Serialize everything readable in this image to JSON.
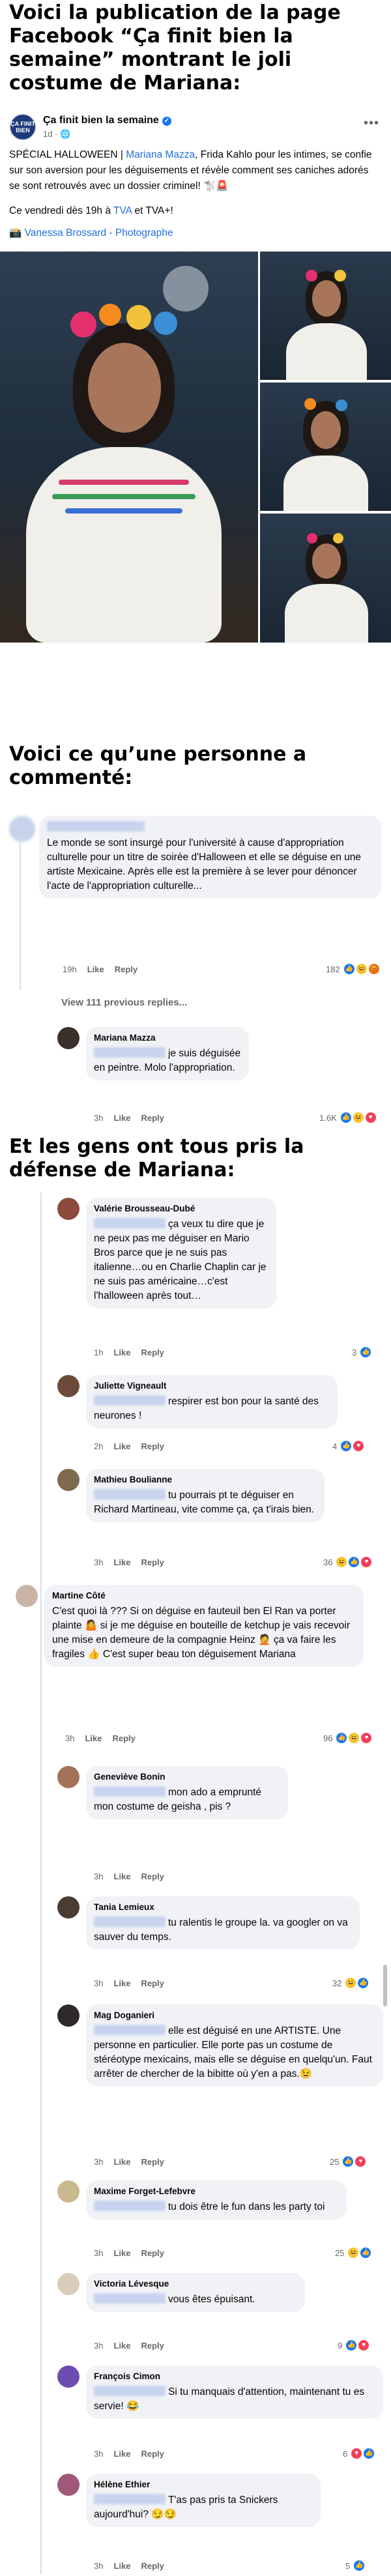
{
  "heading1": [
    "Voici la publication de la page",
    "Facebook “Ça finit bien la",
    "semaine” montrant le joli",
    "costume de Mariana:"
  ],
  "heading2": [
    "Voici ce qu’une personne a",
    "commenté:"
  ],
  "heading3": [
    "Et les gens ont tous pris la",
    "défense de Mariana:"
  ],
  "post": {
    "page_name": "Ça finit bien la semaine",
    "time": "1d",
    "avatar_text": "ÇA FINIT BIEN",
    "text_before": "SPÉCIAL HALLOWEEN | ",
    "text_link": "Mariana Mazza",
    "text_after": ", Frida Kahlo pour les intimes, se confie sur son aversion pour les déguisements et révèle comment ses caniches adorés se sont retrouvés avec un dossier criminel! 🐩🚨",
    "line2_before": "Ce vendredi dès 19h à ",
    "line2_link1": "TVA",
    "line2_mid": " et TVA+!",
    "photo_credit": "📸 Vanessa Brossard - Photographe"
  },
  "first_comment": {
    "text": "Le monde se sont insurgé pour l'université à cause d'appropriation culturelle pour un titre de soirée d'Halloween et elle se déguise en une artiste Mexicaine. Après elle est la première à se lever pour dénoncer l'acte de l'appropriation culturelle...",
    "time": "19h",
    "like": "Like",
    "reply": "Reply",
    "count": "182",
    "view_more": "View 111 previous replies...",
    "reply_name": "Mariana Mazza",
    "reply_text": "je suis déguisée en peintre. Molo l'appropriation.",
    "reply_time": "3h",
    "reply_count": "1.6K"
  },
  "comments": [
    {
      "name": "Valérie Brousseau-Dubé",
      "text": "ça veux tu dire que je ne peux pas me déguiser en Mario Bros parce que je ne suis pas italienne…ou en Charlie Chaplin car je ne suis pas américaine…c'est l'halloween après tout…",
      "time": "1h",
      "count": "3"
    },
    {
      "name": "Juliette Vigneault",
      "text": "respirer est bon pour la santé des neurones !",
      "time": "2h",
      "count": "4"
    },
    {
      "name": "Mathieu Boulianne",
      "text": "tu pourrais pt te déguiser en Richard Martineau, vite comme ça, ça t'irais bien.",
      "time": "3h",
      "count": "36"
    },
    {
      "name": "Martine Côté",
      "text": "C'est quoi là ??? Si on déguise en fauteuil ben  El Ran va porter plainte 🤷 si je me déguise en bouteille de ketchup je vais recevoir une mise en demeure de la compagnie Heinz 🤦 ça va faire les fragiles 👍 C'est super beau ton déguisement Mariana",
      "time": "3h",
      "count": "96"
    },
    {
      "name": "Geneviève Bonin",
      "text": "mon ado a emprunté mon costume de geisha , pis ?",
      "time": "3h",
      "count": ""
    },
    {
      "name": "Tania Lemieux",
      "text": "tu ralentis le groupe la. va googler on va sauver du temps.",
      "time": "3h",
      "count": "32"
    },
    {
      "name": "Mag Doganieri",
      "text": "elle est déguisé en une ARTISTE. Une personne en particulier. Elle porte pas un costume de stéréotype mexicains, mais elle se déguise en quelqu'un. Faut arrêter de chercher de la bibitte où y'en a pas.😉",
      "time": "3h",
      "count": "25"
    },
    {
      "name": "Maxime Forget-Lefebvre",
      "text": "tu dois être le fun dans les party toi",
      "time": "3h",
      "count": "25"
    },
    {
      "name": "Victoria Lévesque",
      "text": "vous êtes épuisant.",
      "time": "3h",
      "count": "9"
    },
    {
      "name": "François Cimon",
      "text": "Si tu manquais d'attention, maintenant tu es servie! 😂",
      "time": "3h",
      "count": "6"
    },
    {
      "name": "Hélène Ethier",
      "text": "T'as pas pris ta Snickers aujourd'hui? 😏😏",
      "time": "3h",
      "count": "5"
    }
  ],
  "labels": {
    "like": "Like",
    "reply": "Reply",
    "more": "•••"
  },
  "colors": {
    "link": "#216fdb",
    "bubble": "#f0f2f5",
    "meta": "#65676b"
  },
  "icons": [
    "verified-badge-icon",
    "globe-icon",
    "more-options-icon",
    "like-reaction-icon",
    "haha-reaction-icon",
    "love-reaction-icon",
    "angry-reaction-icon",
    "wow-reaction-icon"
  ]
}
